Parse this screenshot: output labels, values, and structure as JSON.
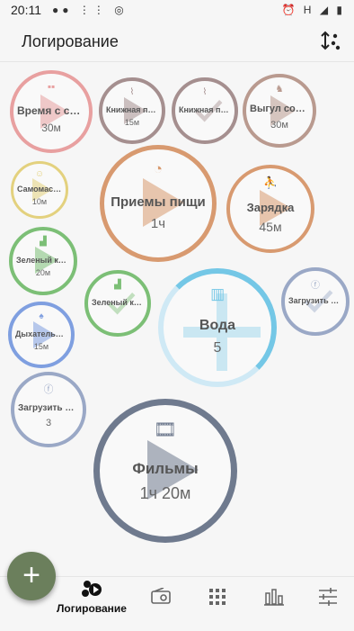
{
  "status": {
    "time": "20:11",
    "network": "H"
  },
  "appbar": {
    "title": "Логирование"
  },
  "bubbles": [
    {
      "key": "family",
      "label": "Время с семьей",
      "duration": "30м",
      "color": "#e8a0a0",
      "icon": "family-icon"
    },
    {
      "key": "bookshelf1",
      "label": "Книжная полка",
      "duration": "15м",
      "color": "#a58f8f",
      "icon": "broom-icon"
    },
    {
      "key": "bookshelf2",
      "label": "Книжная полка",
      "duration": "",
      "color": "#a58f8f",
      "icon": "broom-icon"
    },
    {
      "key": "dog",
      "label": "Выгул собаки",
      "duration": "30м",
      "color": "#b99a8f",
      "icon": "dog-icon"
    },
    {
      "key": "massage",
      "label": "Самомассаж",
      "duration": "10м",
      "color": "#e3d17e",
      "icon": "massage-icon"
    },
    {
      "key": "meals",
      "label": "Приемы пищи",
      "duration": "1ч",
      "color": "#d89a70",
      "icon": "pizza-icon"
    },
    {
      "key": "exercise",
      "label": "Зарядка",
      "duration": "45м",
      "color": "#d89a70",
      "icon": "exercise-icon"
    },
    {
      "key": "green1",
      "label": "Зеленый кокт.",
      "duration": "20м",
      "color": "#7cbf76",
      "icon": "blender-icon"
    },
    {
      "key": "green2",
      "label": "Зеленый кокте.",
      "duration": "",
      "color": "#7cbf76",
      "icon": "blender-icon"
    },
    {
      "key": "water",
      "label": "Вода",
      "duration": "5",
      "color": "#74c7e6",
      "icon": "glass-icon"
    },
    {
      "key": "upload1",
      "label": "Загрузить фото.",
      "duration": "",
      "color": "#9aa8c6",
      "icon": "facebook-icon"
    },
    {
      "key": "breath",
      "label": "Дыхательная .",
      "duration": "15м",
      "color": "#7f9fe0",
      "icon": "lungs-icon"
    },
    {
      "key": "upload2",
      "label": "Загрузить фото.",
      "duration": "3",
      "color": "#9aa8c6",
      "icon": "facebook-icon"
    },
    {
      "key": "movies",
      "label": "Фильмы",
      "duration": "1ч 20м",
      "color": "#6f7a8e",
      "icon": "film-icon"
    }
  ],
  "fab": {
    "label": "+"
  },
  "nav": {
    "active_label": "Логирование"
  }
}
